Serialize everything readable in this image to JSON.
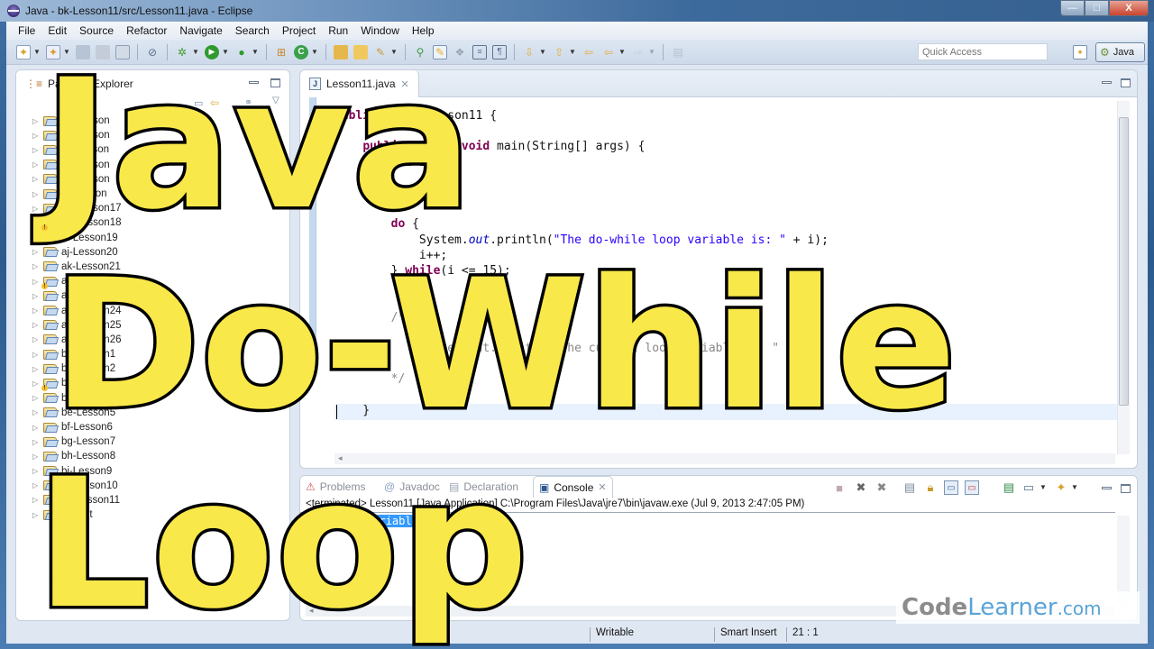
{
  "window": {
    "title": "Java - bk-Lesson11/src/Lesson11.java - Eclipse",
    "controls": {
      "minimize": "—",
      "maximize": "□",
      "close": "X"
    }
  },
  "menu": [
    "File",
    "Edit",
    "Source",
    "Refactor",
    "Navigate",
    "Search",
    "Project",
    "Run",
    "Window",
    "Help"
  ],
  "toolbar": {
    "quick_access_placeholder": "Quick Access",
    "perspective_label": "Java",
    "icons": [
      "new-icon",
      "new-wizard-icon",
      "save-icon",
      "save-all-icon",
      "print-icon",
      "toggle-breakpoint-icon",
      "debug-icon",
      "run-icon",
      "run-external-icon",
      "new-package-icon",
      "new-class-icon",
      "open-type-icon",
      "open-folder-icon",
      "search-icon",
      "mark-occurrences-icon",
      "highlight-icon",
      "toggle-block-icon",
      "show-whitespace-icon",
      "pilcrow-icon",
      "next-annotation-icon",
      "last-edit-icon",
      "back-icon",
      "forward-icon",
      "pin-icon"
    ]
  },
  "package_explorer": {
    "tab_label": "Package Explorer",
    "projects": [
      {
        "name": "aa-Lesson",
        "warn": false
      },
      {
        "name": "ab-Lesson",
        "warn": false
      },
      {
        "name": "ac-Lesson",
        "warn": false
      },
      {
        "name": "ad-Lesson",
        "warn": false
      },
      {
        "name": "ae-Lesson",
        "warn": false
      },
      {
        "name": "af-Lesson",
        "warn": false
      },
      {
        "name": "ag-Lesson17",
        "warn": false
      },
      {
        "name": "ah-Lesson18",
        "warn": true
      },
      {
        "name": "ai-Lesson19",
        "warn": false
      },
      {
        "name": "aj-Lesson20",
        "warn": false
      },
      {
        "name": "ak-Lesson21",
        "warn": false
      },
      {
        "name": "al-Lesson22",
        "warn": true
      },
      {
        "name": "am-Lesson23",
        "warn": false
      },
      {
        "name": "an-Lesson24",
        "warn": false
      },
      {
        "name": "ao-Lesson25",
        "warn": false
      },
      {
        "name": "ap-Lesson26",
        "warn": false
      },
      {
        "name": "ba-Lesson1",
        "warn": false
      },
      {
        "name": "bb-Lesson2",
        "warn": false
      },
      {
        "name": "bc-Lesson3",
        "warn": true
      },
      {
        "name": "bd-Lesson4",
        "warn": false
      },
      {
        "name": "be-Lesson5",
        "warn": false
      },
      {
        "name": "bf-Lesson6",
        "warn": false
      },
      {
        "name": "bg-Lesson7",
        "warn": false
      },
      {
        "name": "bh-Lesson8",
        "warn": false
      },
      {
        "name": "bi-Lesson9",
        "warn": false
      },
      {
        "name": "bj-Lesson10",
        "warn": false
      },
      {
        "name": "bk-Lesson11",
        "warn": false
      },
      {
        "name": "Output",
        "warn": false
      }
    ]
  },
  "editor": {
    "tab_label": "Lesson11.java",
    "code_lines": [
      [
        [
          "kw",
          "public "
        ],
        [
          "kw",
          "class "
        ],
        [
          "",
          "Lesson11 {"
        ]
      ],
      [
        [
          "",
          ""
        ]
      ],
      [
        [
          "",
          "    "
        ],
        [
          "kw",
          "public static void "
        ],
        [
          "",
          "main(String[] args) {"
        ]
      ],
      [
        [
          "",
          "        "
        ],
        [
          "kw",
          "int "
        ],
        [
          "",
          "i = 1;"
        ]
      ],
      [
        [
          "",
          ""
        ]
      ],
      [
        [
          "",
          ""
        ]
      ],
      [
        [
          "",
          ""
        ]
      ],
      [
        [
          "",
          "        "
        ],
        [
          "kw",
          "do "
        ],
        [
          "",
          "{"
        ]
      ],
      [
        [
          "",
          "            System."
        ],
        [
          "fld",
          "out"
        ],
        [
          "",
          ".println("
        ],
        [
          "str",
          "\"The do-while loop variable is: \""
        ],
        [
          "",
          " + i);"
        ]
      ],
      [
        [
          "",
          "            i++;"
        ]
      ],
      [
        [
          "",
          "        } "
        ],
        [
          "kw",
          "while"
        ],
        [
          "",
          "(i <= 15);"
        ]
      ],
      [
        [
          "",
          ""
        ]
      ],
      [
        [
          "",
          ""
        ]
      ],
      [
        [
          "",
          "        "
        ],
        [
          "cm",
          "/*"
        ]
      ],
      [
        [
          "",
          ""
        ]
      ],
      [
        [
          "",
          "            "
        ],
        [
          "cm",
          "System.out.println(\"The current loop variable is: \" + i);"
        ]
      ],
      [
        [
          "",
          "            "
        ],
        [
          "cm",
          "i++;"
        ]
      ],
      [
        [
          "",
          "        "
        ],
        [
          "cm",
          "*/"
        ]
      ],
      [
        [
          "",
          ""
        ]
      ],
      [
        [
          "",
          "    }"
        ]
      ]
    ]
  },
  "console": {
    "tabs": [
      {
        "label": "Problems",
        "icon": "problems-icon",
        "active": false
      },
      {
        "label": "Javadoc",
        "icon": "at-icon",
        "active": false
      },
      {
        "label": "Declaration",
        "icon": "declaration-icon",
        "active": false
      },
      {
        "label": "Console",
        "icon": "console-icon",
        "active": true
      }
    ],
    "header": "<terminated> Lesson11 [Java Application] C:\\Program Files\\Java\\jre7\\bin\\javaw.exe (Jul 9, 2013 2:47:05 PM)",
    "output_line": "The loop variable is: 88",
    "tool_icons": [
      "terminate-icon",
      "remove-launch-icon",
      "remove-all-icon",
      "clear-console-icon",
      "scroll-lock-icon",
      "show-stdout-icon",
      "show-stderr-icon",
      "pin-console-icon",
      "display-console-icon",
      "open-console-icon"
    ]
  },
  "status": {
    "writable": "Writable",
    "insert_mode": "Smart Insert",
    "position": "21 : 1"
  },
  "overlay": {
    "line1": "Java",
    "line2": "Do-While",
    "line3": "Loop"
  },
  "watermark": {
    "code": "Code",
    "learner": "Learner",
    "com": ".com"
  },
  "colors": {
    "overlay_fill": "#f9e84a",
    "keyword": "#7f0055",
    "string": "#2a00ff",
    "selection": "#3399ff"
  }
}
